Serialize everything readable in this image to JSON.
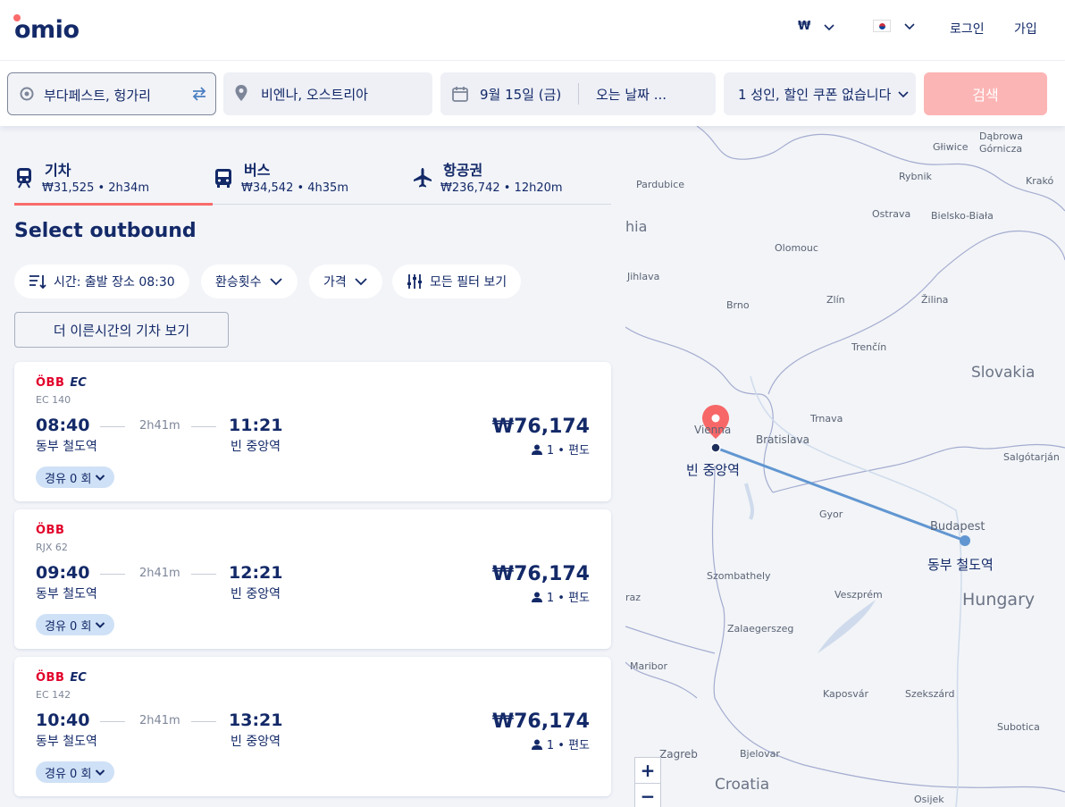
{
  "header": {
    "logo": "omio",
    "currency": "₩",
    "login": "로그인",
    "signup": "가입"
  },
  "search": {
    "origin": "부다페스트, 헝가리",
    "destination": "비엔나, 오스트리아",
    "date": "9월 15일 (금)",
    "return": "오는 날짜 ...",
    "passengers": "1 성인, 할인 쿠폰 없습니다",
    "button": "검색"
  },
  "tabs": [
    {
      "name": "기차",
      "meta": "₩31,525 • 2h34m",
      "icon": "train-icon"
    },
    {
      "name": "버스",
      "meta": "₩34,542 • 4h35m",
      "icon": "bus-icon"
    },
    {
      "name": "항공권",
      "meta": "₩236,742 • 12h20m",
      "icon": "plane-icon"
    }
  ],
  "heading": "Select outbound",
  "filters": {
    "time": "시간: 출발 장소 08:30",
    "transfers": "환승횟수",
    "price": "가격",
    "all": "모든 필터 보기"
  },
  "earlier_button": "더 이른시간의 기차 보기",
  "results": [
    {
      "brand": "ÖBB",
      "ec": "EC",
      "code": "EC 140",
      "dep": "08:40",
      "arr": "11:21",
      "dur": "2h41m",
      "dep_station": "동부 철도역",
      "arr_station": "빈 중앙역",
      "price": "₩76,174",
      "pax": "1 • 편도",
      "stops": "경유 0 회"
    },
    {
      "brand": "ÖBB",
      "ec": "",
      "code": "RJX 62",
      "dep": "09:40",
      "arr": "12:21",
      "dur": "2h41m",
      "dep_station": "동부 철도역",
      "arr_station": "빈 중앙역",
      "price": "₩76,174",
      "pax": "1 • 편도",
      "stops": "경유 0 회"
    },
    {
      "brand": "ÖBB",
      "ec": "EC",
      "code": "EC 142",
      "dep": "10:40",
      "arr": "13:21",
      "dur": "2h41m",
      "dep_station": "동부 철도역",
      "arr_station": "빈 중앙역",
      "price": "₩76,174",
      "pax": "1 • 편도",
      "stops": "경유 0 회"
    }
  ],
  "map": {
    "cities": [
      "Głiwice",
      "Dąbrowa",
      "Górnicza",
      "Pardubice",
      "Rybnik",
      "Krakó",
      "hia",
      "Ostrava",
      "Bielsko-Biała",
      "Olomouc",
      "Jihlava",
      "Zlín",
      "Brno",
      "Žilina",
      "Trenčín",
      "Trnava",
      "Vienna",
      "Bratislava",
      "Salgótarján",
      "Gyor",
      "Budapest",
      "raz",
      "Szombathely",
      "Veszprém",
      "Zalaegerszeg",
      "Maribor",
      "Kaposvár",
      "Szekszárd",
      "Subotica",
      "Zagreb",
      "Bjelovar",
      "Osijek"
    ],
    "countries": [
      "Slovakia",
      "Hungary",
      "Croatia"
    ],
    "station_origin": "동부 철도역",
    "station_dest": "빈 중앙역",
    "zoom_in": "+",
    "zoom_out": "−"
  }
}
